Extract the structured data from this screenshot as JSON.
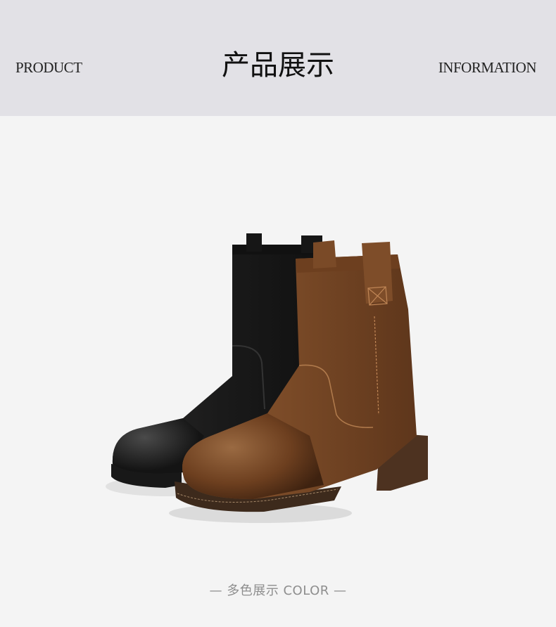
{
  "header": {
    "left_label": "PRODUCT",
    "title": "产品展示",
    "right_label": "INFORMATION"
  },
  "caption": "— 多色展示 COLOR —",
  "product_colors": [
    "#1c1b1b",
    "#7a4a26"
  ]
}
